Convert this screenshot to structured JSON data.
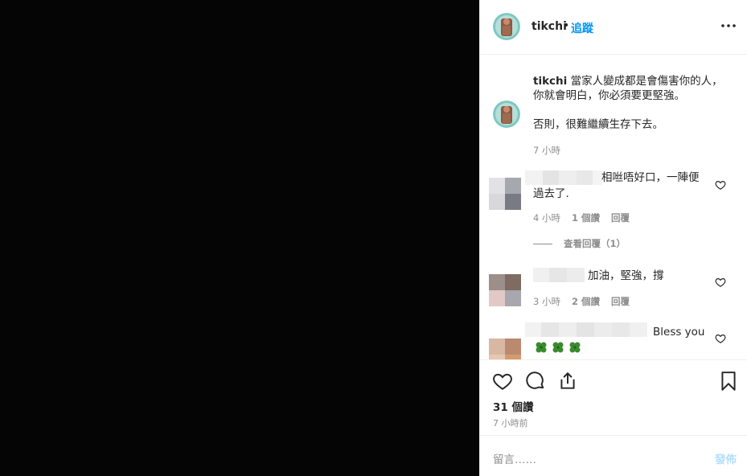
{
  "post": {
    "username": "tikchi",
    "dot": "•",
    "follow_label": "追蹤",
    "caption_user": "tikchi",
    "caption_text": " 當家人變成都是會傷害你的人，\n你就會明白，你必須要更堅強。\n\n否則，很難繼續生存下去。",
    "caption_time": "7 小時"
  },
  "comments": [
    {
      "text_line1": "相咝唔好口，一陣便",
      "text_line2": "過去了.",
      "time": "4 小時",
      "likes": "1 個讚",
      "reply_label": "回覆",
      "view_replies": "查看回覆（1）"
    },
    {
      "text_line1": "加油，堅強，撐",
      "time": "3 小時",
      "likes": "2 個讚",
      "reply_label": "回覆"
    },
    {
      "text_line1": "Bless you",
      "emoji": "🍀🍀🍀"
    }
  ],
  "footer": {
    "likes": "31 個讚",
    "time_ago": "7 小時前",
    "comment_placeholder": "留言……",
    "post_label": "發佈"
  },
  "icons": {
    "more": "more-options-icon",
    "heart": "heart-icon",
    "comment": "comment-icon",
    "share": "share-icon",
    "bookmark": "bookmark-icon"
  }
}
